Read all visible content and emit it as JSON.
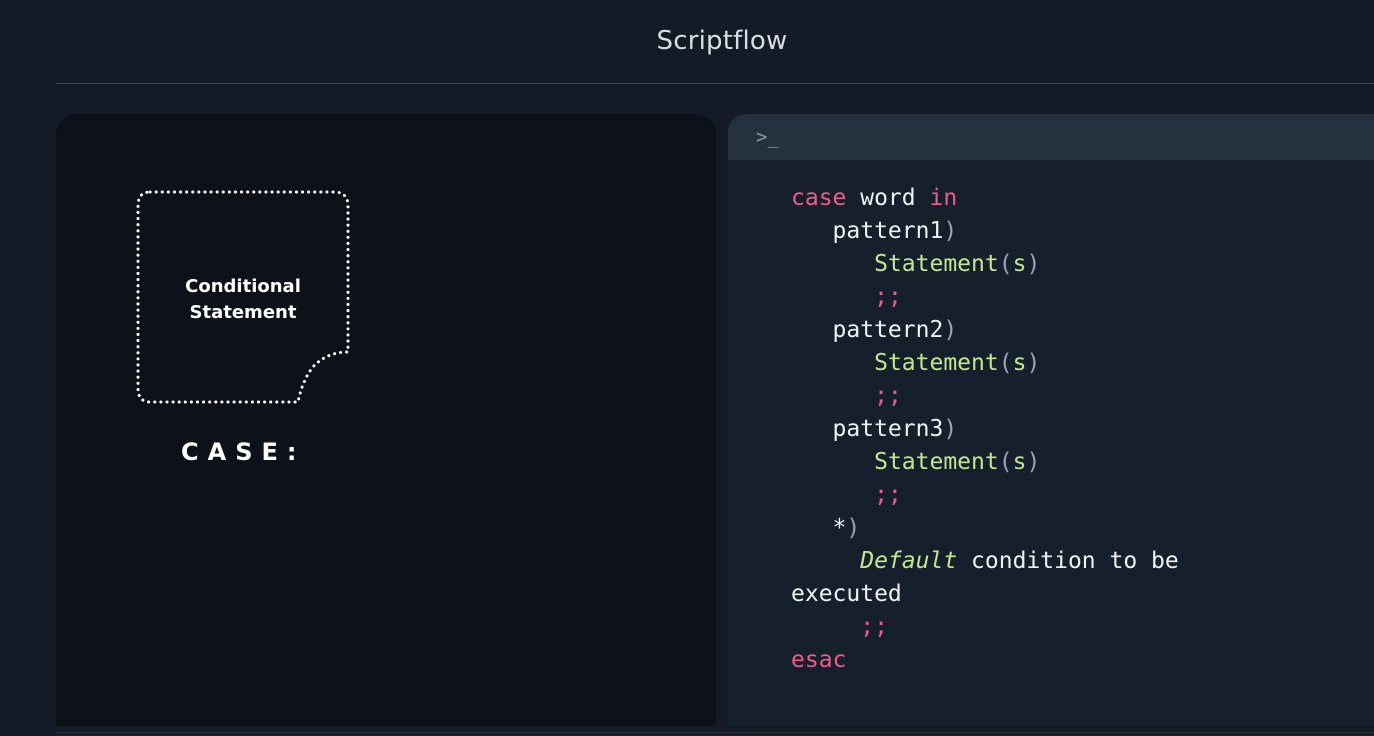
{
  "app": {
    "title": "Scriptflow"
  },
  "left_panel": {
    "node_label_line1": "Conditional",
    "node_label_line2": "Statement",
    "section_label": "CASE:"
  },
  "terminal": {
    "prompt": ">_",
    "code": {
      "l1_kw": "case",
      "l1_word": " word ",
      "l1_in": "in",
      "pattern1": "pattern1",
      "pattern2": "pattern2",
      "pattern3": "pattern3",
      "close_paren": ")",
      "statement": "Statement",
      "open_paren": "(",
      "s": "s",
      "double_semicolon": ";;",
      "star": "*",
      "default_it": "Default",
      "default_rest": " condition to be",
      "executed": "executed",
      "esac": "esac"
    }
  },
  "colors": {
    "background": "#141b26",
    "left_panel": "#0c111a",
    "terminal": "#16202c",
    "terminal_bar": "#263140",
    "keyword": "#ef5b8a",
    "string": "#c3e68f"
  },
  "icons": {
    "document_shape": "dotted-document-icon",
    "terminal_prompt": "terminal-prompt-icon"
  }
}
